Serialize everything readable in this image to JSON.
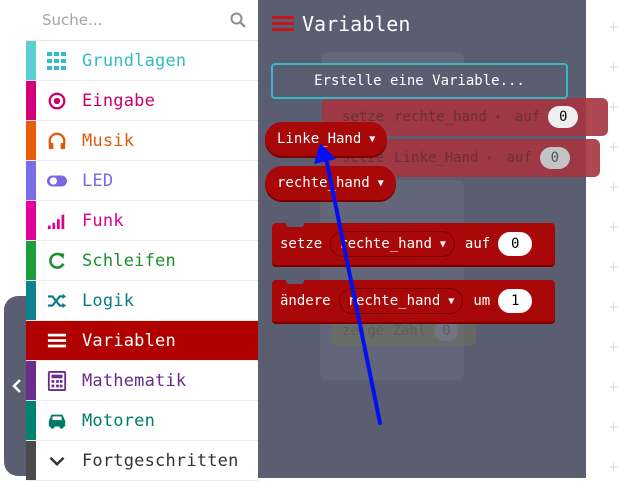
{
  "search": {
    "placeholder": "Suche..."
  },
  "categories": [
    {
      "label": "Grundlagen",
      "color": "#1e90ff",
      "icon": "grid-icon"
    },
    {
      "label": "Eingabe",
      "color": "#d400d4",
      "icon": "target-icon"
    },
    {
      "label": "Musik",
      "color": "#e63022",
      "icon": "headphones-icon"
    },
    {
      "label": "LED",
      "color": "#5c2d91",
      "icon": "toggle-icon"
    },
    {
      "label": "Funk",
      "color": "#e3008c",
      "icon": "signal-bars-icon"
    },
    {
      "label": "Schleifen",
      "color": "#00aa00",
      "icon": "refresh-icon"
    },
    {
      "label": "Logik",
      "color": "#00a4a6",
      "icon": "shuffle-icon"
    },
    {
      "label": "Variablen",
      "color": "#b00000",
      "icon": "list-icon"
    },
    {
      "label": "Mathematik",
      "color": "#712672",
      "icon": "calculator-icon"
    },
    {
      "label": "Motoren",
      "color": "#008272",
      "icon": "car-icon"
    },
    {
      "label": "Fortgeschritten",
      "color": "#3c3c3c",
      "icon": "chevron-down-icon"
    }
  ],
  "flyout": {
    "title": "Variablen",
    "create_button": "Erstelle eine Variable...",
    "variables": [
      "Linke_Hand",
      "rechte_hand"
    ],
    "set_block": {
      "keyword": "setze",
      "variable": "rechte_hand",
      "to": "auf",
      "value": "0"
    },
    "change_block": {
      "keyword": "ändere",
      "variable": "rechte_hand",
      "by": "um",
      "value": "1"
    }
  },
  "background_blocks": {
    "set1": {
      "keyword": "setze",
      "variable": "rechte_hand",
      "to": "auf",
      "value": "0"
    },
    "set2": {
      "keyword": "setze",
      "variable": "Linke_Hand",
      "to": "auf",
      "value": "0"
    },
    "show": {
      "keyword": "zeige Zahl",
      "value": "0"
    }
  },
  "colors": {
    "flyout_bg": "#5b5e70",
    "variable_block": "#a80808",
    "create_button_border": "#36b9c5",
    "annotation_arrow": "#0000ff"
  }
}
